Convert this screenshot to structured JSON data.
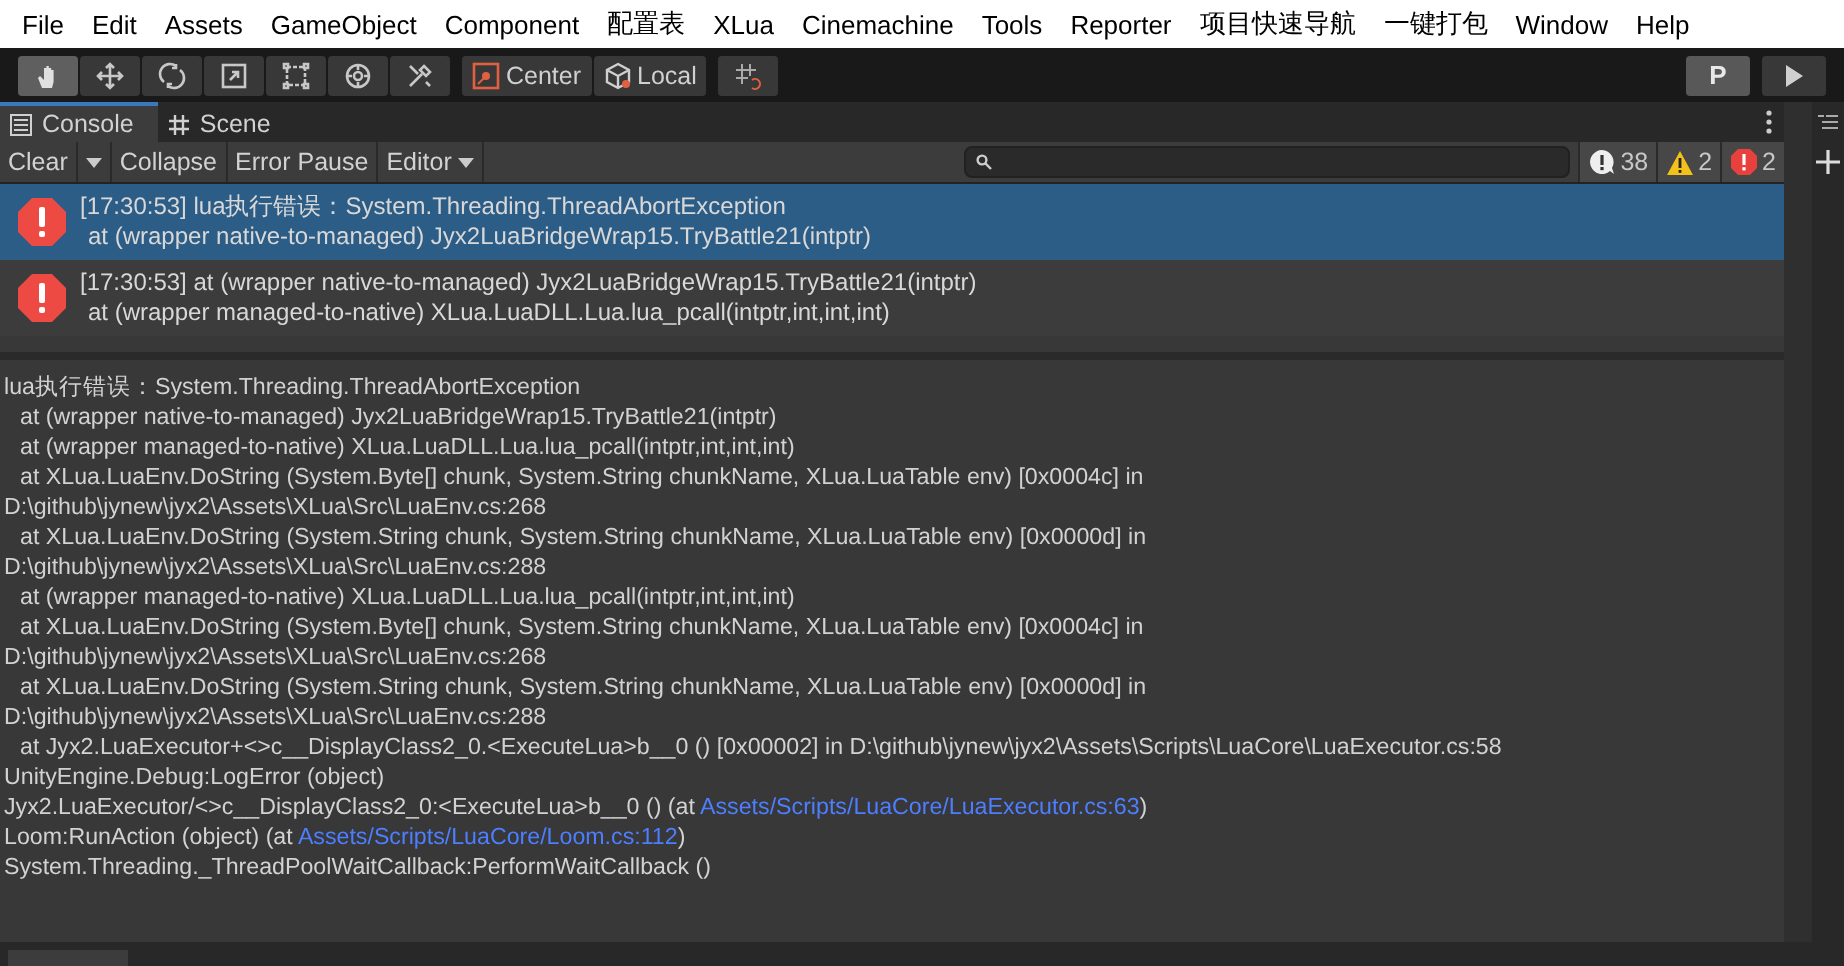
{
  "menu_bar": [
    "File",
    "Edit",
    "Assets",
    "GameObject",
    "Component",
    "配置表",
    "XLua",
    "Cinemachine",
    "Tools",
    "Reporter",
    "项目快速导航",
    "一键打包",
    "Window",
    "Help"
  ],
  "toolbar": {
    "tools": [
      {
        "kind": "hand",
        "selected": true
      },
      {
        "kind": "move",
        "selected": false
      },
      {
        "kind": "rotate",
        "selected": false
      },
      {
        "kind": "scale",
        "selected": false
      },
      {
        "kind": "rect",
        "selected": false
      },
      {
        "kind": "transform",
        "selected": false
      },
      {
        "kind": "custom",
        "selected": false
      }
    ],
    "pivot_buttons": [
      {
        "kind": "center",
        "label": "Center"
      },
      {
        "kind": "local",
        "label": "Local"
      }
    ],
    "p_button": "P"
  },
  "tabs": [
    {
      "label": "Console",
      "kind": "console",
      "selected": true
    },
    {
      "label": "Scene",
      "kind": "scene",
      "selected": false
    }
  ],
  "console_toolbar": {
    "buttons": [
      {
        "kind": "button",
        "label": "Clear"
      },
      {
        "kind": "caret"
      },
      {
        "kind": "button",
        "label": "Collapse"
      },
      {
        "kind": "button",
        "label": "Error Pause"
      },
      {
        "kind": "dropdown",
        "label": "Editor"
      }
    ],
    "counters": [
      {
        "kind": "info",
        "count": "38"
      },
      {
        "kind": "warning",
        "count": "2"
      },
      {
        "kind": "error",
        "count": "2"
      }
    ]
  },
  "log_entries": [
    {
      "selected": true,
      "time": "[17:30:53]",
      "line_1": "lua执行错误：System.Threading.ThreadAbortException",
      "line_2": "at (wrapper native-to-managed) Jyx2LuaBridgeWrap15.TryBattle21(intptr)"
    },
    {
      "selected": false,
      "time": "[17:30:53]",
      "line_1": "at (wrapper native-to-managed) Jyx2LuaBridgeWrap15.TryBattle21(intptr)",
      "line_2": "at (wrapper managed-to-native) XLua.LuaDLL.Lua.lua_pcall(intptr,int,int,int)"
    }
  ],
  "details": [
    {
      "indent": false,
      "text": "lua执行错误：System.Threading.ThreadAbortException"
    },
    {
      "indent": true,
      "text": "at (wrapper native-to-managed) Jyx2LuaBridgeWrap15.TryBattle21(intptr)"
    },
    {
      "indent": true,
      "text": "at (wrapper managed-to-native) XLua.LuaDLL.Lua.lua_pcall(intptr,int,int,int)"
    },
    {
      "indent": true,
      "text": "at XLua.LuaEnv.DoString (System.Byte[] chunk, System.String chunkName, XLua.LuaTable env) [0x0004c] in"
    },
    {
      "indent": false,
      "text": "D:\\github\\jynew\\jyx2\\Assets\\XLua\\Src\\LuaEnv.cs:268"
    },
    {
      "indent": true,
      "text": "at XLua.LuaEnv.DoString (System.String chunk, System.String chunkName, XLua.LuaTable env) [0x0000d] in"
    },
    {
      "indent": false,
      "text": "D:\\github\\jynew\\jyx2\\Assets\\XLua\\Src\\LuaEnv.cs:288"
    },
    {
      "indent": true,
      "text": "at (wrapper managed-to-native) XLua.LuaDLL.Lua.lua_pcall(intptr,int,int,int)"
    },
    {
      "indent": true,
      "text": "at XLua.LuaEnv.DoString (System.Byte[] chunk, System.String chunkName, XLua.LuaTable env) [0x0004c] in"
    },
    {
      "indent": false,
      "text": "D:\\github\\jynew\\jyx2\\Assets\\XLua\\Src\\LuaEnv.cs:268"
    },
    {
      "indent": true,
      "text": "at XLua.LuaEnv.DoString (System.String chunk, System.String chunkName, XLua.LuaTable env) [0x0000d] in"
    },
    {
      "indent": false,
      "text": "D:\\github\\jynew\\jyx2\\Assets\\XLua\\Src\\LuaEnv.cs:288"
    },
    {
      "indent": true,
      "text": "at Jyx2.LuaExecutor+<>c__DisplayClass2_0.<ExecuteLua>b__0 () [0x00002] in D:\\github\\jynew\\jyx2\\Assets\\Scripts\\LuaCore\\LuaExecutor.cs:58"
    },
    {
      "indent": false,
      "text": "UnityEngine.Debug:LogError (object)"
    },
    {
      "indent": false,
      "text": "Jyx2.LuaExecutor/<>c__DisplayClass2_0:<ExecuteLua>b__0 () (at ",
      "link": "Assets/Scripts/LuaCore/LuaExecutor.cs:63",
      "after": ")"
    },
    {
      "indent": false,
      "text": "Loom:RunAction (object) (at ",
      "link": "Assets/Scripts/LuaCore/Loom.cs:112",
      "after": ")"
    },
    {
      "indent": false,
      "text": "System.Threading._ThreadPoolWaitCallback:PerformWaitCallback ()"
    }
  ]
}
